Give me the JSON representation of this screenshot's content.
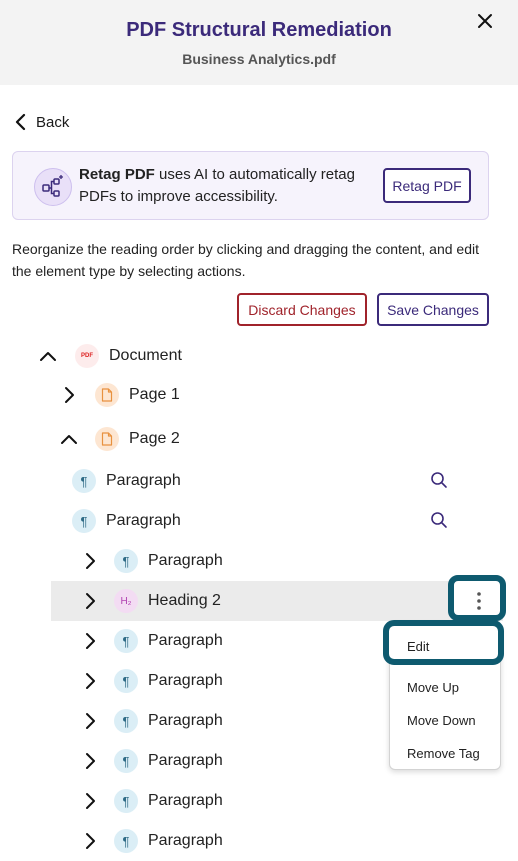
{
  "header": {
    "title": "PDF Structural Remediation",
    "subtitle": "Business Analytics.pdf",
    "close_icon": "close-icon"
  },
  "nav": {
    "back_label": "Back"
  },
  "banner": {
    "bold_text": "Retag PDF",
    "rest_text": " uses AI to automatically retag PDFs to improve accessibility.",
    "button_label": "Retag PDF",
    "icon": "workflow-sparkle-icon"
  },
  "instructions": "Reorganize the reading order by clicking and dragging the content, and edit the element type by selecting actions.",
  "actions": {
    "discard_label": "Discard Changes",
    "save_label": "Save Changes"
  },
  "colors": {
    "accent": "#3b2a7a",
    "danger": "#a0232b",
    "highlight_ring": "#0e5a6f",
    "selected_row": "#ebebeb"
  },
  "tree": {
    "document": {
      "label": "Document",
      "chip": "PDF",
      "expanded": true
    },
    "page1": {
      "label": "Page 1",
      "expanded": false
    },
    "page2": {
      "label": "Page 2",
      "expanded": true
    },
    "items": [
      {
        "label": "Paragraph",
        "chip": "¶",
        "has_search": true
      },
      {
        "label": "Paragraph",
        "chip": "¶",
        "has_search": true
      },
      {
        "label": "Paragraph",
        "chip": "¶"
      },
      {
        "label": "Heading 2",
        "chip": "H₂",
        "selected": true
      },
      {
        "label": "Paragraph",
        "chip": "¶"
      },
      {
        "label": "Paragraph",
        "chip": "¶"
      },
      {
        "label": "Paragraph",
        "chip": "¶"
      },
      {
        "label": "Paragraph",
        "chip": "¶"
      },
      {
        "label": "Paragraph",
        "chip": "¶"
      },
      {
        "label": "Paragraph",
        "chip": "¶"
      }
    ]
  },
  "context_menu": {
    "items": [
      "Edit",
      "Move Up",
      "Move Down",
      "Remove Tag"
    ]
  }
}
